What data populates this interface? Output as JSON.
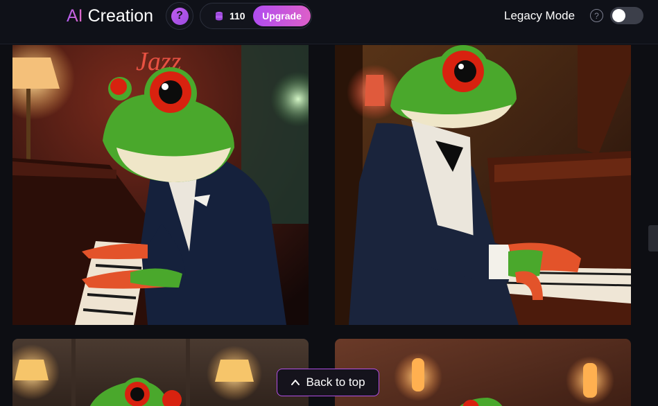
{
  "header": {
    "brand_prefix": "AI",
    "brand_suffix": " Creation",
    "help_glyph": "?",
    "credits": "110",
    "upgrade_label": "Upgrade",
    "legacy_label": "Legacy Mode",
    "legacy_help_glyph": "?",
    "legacy_mode_on": false
  },
  "gallery": {
    "images": [
      {
        "sign_text": "Jazz"
      },
      {
        "sign_text": ""
      },
      {
        "sign_text": ""
      },
      {
        "sign_text": ""
      }
    ]
  },
  "back_to_top_label": "Back to top",
  "colors": {
    "accent": "#b04cf0",
    "accent_pink": "#dd5fc9",
    "background": "#0d0e13",
    "frog_green": "#4aa82c",
    "frog_eye": "#d8220f"
  },
  "icons": [
    "help-icon",
    "coin-stack-icon",
    "question-circle-icon",
    "chevron-up-icon"
  ]
}
